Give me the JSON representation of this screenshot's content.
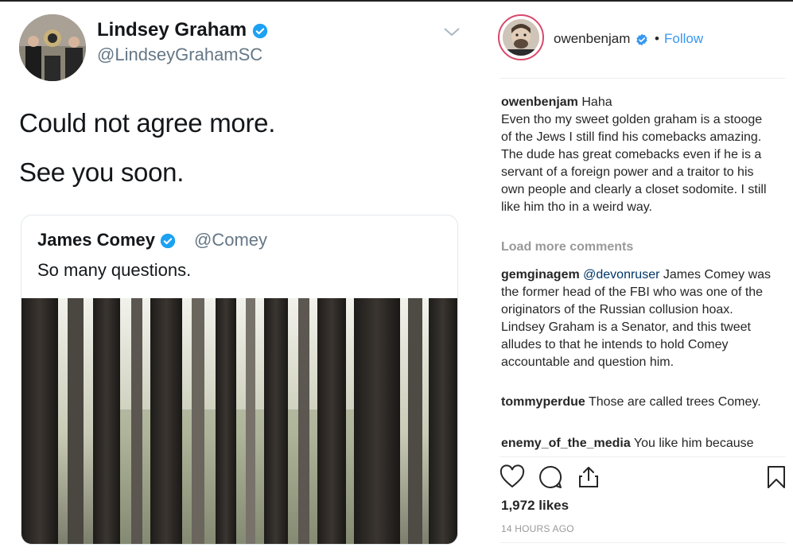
{
  "tweet": {
    "author_name": "Lindsey Graham",
    "author_handle": "@LindseyGrahamSC",
    "line1": "Could not agree more.",
    "line2": "See you soon.",
    "quoted": {
      "author_name": "James Comey",
      "author_handle": "@Comey",
      "text": "So many questions."
    }
  },
  "post": {
    "username": "owenbenjam",
    "separator": "•",
    "follow_label": "Follow",
    "caption": {
      "user": "owenbenjam",
      "text": "Haha\nEven tho my sweet golden graham is a stooge of the Jews I still find his comebacks amazing. The dude has great comebacks even if he is a servant of a foreign power and a traitor to his own people and clearly a closet sodomite. I still like him tho in a weird way."
    },
    "load_more": "Load more comments",
    "comments": [
      {
        "user": "gemginagem",
        "mention": "@devonruser",
        "text": " James Comey was the former head of the FBI who was one of the originators of the Russian collusion hoax. Lindsey Graham is a Senator, and this tweet alludes to that he intends to hold Comey accountable and question him."
      },
      {
        "user": "tommyperdue",
        "mention": "",
        "text": " Those are called trees Comey."
      },
      {
        "user": "enemy_of_the_media",
        "mention": "",
        "text": " You like him because"
      }
    ],
    "likes": "1,972 likes",
    "timestamp": "14 HOURS AGO"
  },
  "icons": {
    "verified": "verified-badge-icon",
    "chevron": "chevron-down-icon",
    "like": "heart-icon",
    "comment": "comment-icon",
    "share": "share-icon",
    "save": "bookmark-icon"
  },
  "colors": {
    "twitter_blue": "#1da1f2",
    "instagram_blue": "#3897f0",
    "instagram_ring": "#d9486a"
  }
}
